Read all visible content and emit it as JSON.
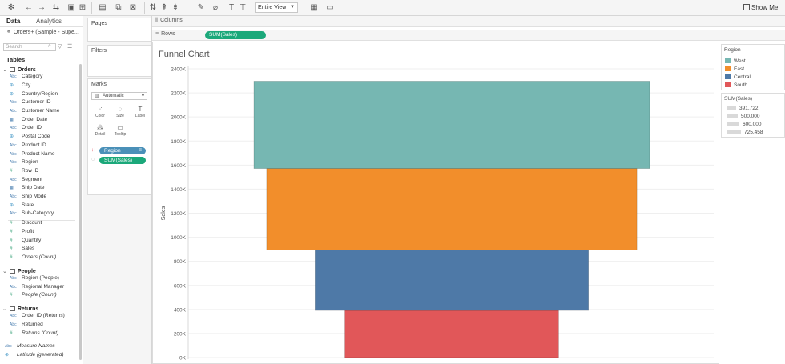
{
  "toolbar": {
    "view_mode": "Entire View",
    "show_me_label": "Show Me"
  },
  "data_pane": {
    "tab_data": "Data",
    "tab_analytics": "Analytics",
    "datasource": "Orders+ (Sample - Supe...",
    "search_placeholder": "Search",
    "tables_header": "Tables",
    "groups": [
      {
        "name": "Orders",
        "fields": [
          {
            "type": "Abc",
            "name": "Category"
          },
          {
            "type": "geo",
            "name": "City"
          },
          {
            "type": "geo",
            "name": "Country/Region"
          },
          {
            "type": "Abc",
            "name": "Customer ID"
          },
          {
            "type": "Abc",
            "name": "Customer Name"
          },
          {
            "type": "date",
            "name": "Order Date"
          },
          {
            "type": "Abc",
            "name": "Order ID"
          },
          {
            "type": "geo",
            "name": "Postal Code"
          },
          {
            "type": "Abc",
            "name": "Product ID"
          },
          {
            "type": "Abc",
            "name": "Product Name"
          },
          {
            "type": "Abc",
            "name": "Region"
          },
          {
            "type": "#",
            "name": "Row ID"
          },
          {
            "type": "Abc",
            "name": "Segment"
          },
          {
            "type": "date",
            "name": "Ship Date"
          },
          {
            "type": "Abc",
            "name": "Ship Mode"
          },
          {
            "type": "geo",
            "name": "State"
          },
          {
            "type": "Abc",
            "name": "Sub-Category"
          },
          {
            "type": "#",
            "name": "Discount"
          },
          {
            "type": "#",
            "name": "Profit"
          },
          {
            "type": "#",
            "name": "Quantity"
          },
          {
            "type": "#",
            "name": "Sales"
          },
          {
            "type": "#",
            "name": "Orders (Count)"
          }
        ]
      },
      {
        "name": "People",
        "fields": [
          {
            "type": "Abc",
            "name": "Region (People)"
          },
          {
            "type": "Abc",
            "name": "Regional Manager"
          },
          {
            "type": "#",
            "name": "People (Count)"
          }
        ]
      },
      {
        "name": "Returns",
        "fields": [
          {
            "type": "Abc",
            "name": "Order ID (Returns)"
          },
          {
            "type": "Abc",
            "name": "Returned"
          },
          {
            "type": "#",
            "name": "Returns (Count)"
          }
        ]
      }
    ],
    "extra_fields": [
      {
        "type": "Abc",
        "name": "Measure Names"
      },
      {
        "type": "geo",
        "name": "Latitude (generated)"
      }
    ]
  },
  "cards": {
    "pages": "Pages",
    "filters": "Filters",
    "marks": "Marks",
    "mark_type": "Automatic",
    "buttons": [
      "Color",
      "Size",
      "Label",
      "Detail",
      "Tooltip"
    ],
    "mark_pills": [
      "Region",
      "SUM(Sales)"
    ]
  },
  "shelves": {
    "columns_label": "Columns",
    "rows_label": "Rows",
    "rows_pill": "SUM(Sales)"
  },
  "viz": {
    "title": "Funnel Chart"
  },
  "region_legend": {
    "title": "Region",
    "items": [
      {
        "name": "West",
        "color": "#76b7b2"
      },
      {
        "name": "East",
        "color": "#f28e2b"
      },
      {
        "name": "Central",
        "color": "#4e79a7"
      },
      {
        "name": "South",
        "color": "#e15759"
      }
    ]
  },
  "size_legend": {
    "title": "SUM(Sales)",
    "items": [
      "391,722",
      "500,000",
      "600,000",
      "725,458"
    ]
  },
  "chart_data": {
    "type": "bar",
    "title": "Funnel Chart",
    "ylabel": "Sales",
    "ylim": [
      0,
      2400000
    ],
    "yticks": [
      "0K",
      "200K",
      "400K",
      "600K",
      "800K",
      "1000K",
      "1200K",
      "1400K",
      "1600K",
      "1800K",
      "2000K",
      "2200K",
      "2400K"
    ],
    "stacked": true,
    "series": [
      {
        "name": "South",
        "value": 391722,
        "color": "#e15759"
      },
      {
        "name": "Central",
        "value": 501240,
        "color": "#4e79a7"
      },
      {
        "name": "East",
        "value": 678781,
        "color": "#f28e2b"
      },
      {
        "name": "West",
        "value": 725458,
        "color": "#76b7b2"
      }
    ]
  }
}
